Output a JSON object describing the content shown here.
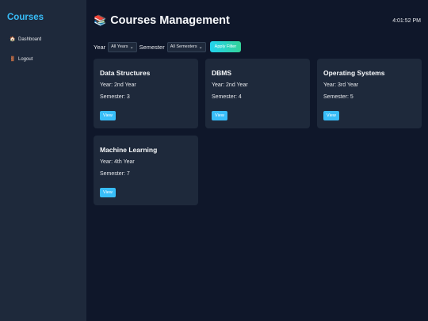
{
  "sidebar": {
    "brand": "Courses",
    "items": [
      {
        "icon": "🏠",
        "label": "Dashboard"
      },
      {
        "icon": "🚪",
        "label": "Logout"
      }
    ]
  },
  "header": {
    "icon": "📚",
    "title": "Courses Management",
    "clock": "4:01:52 PM"
  },
  "filters": {
    "year_label": "Year",
    "year_value": "All Years",
    "semester_label": "Semester",
    "semester_value": "All Semesters",
    "apply_label": "Apply Filter"
  },
  "courses": [
    {
      "title": "Data Structures",
      "year": "Year: 2nd Year",
      "semester": "Semester: 3",
      "button": "View"
    },
    {
      "title": "DBMS",
      "year": "Year: 2nd Year",
      "semester": "Semester: 4",
      "button": "View"
    },
    {
      "title": "Operating Systems",
      "year": "Year: 3rd Year",
      "semester": "Semester: 5",
      "button": "View"
    },
    {
      "title": "Machine Learning",
      "year": "Year: 4th Year",
      "semester": "Semester: 7",
      "button": "View"
    }
  ]
}
